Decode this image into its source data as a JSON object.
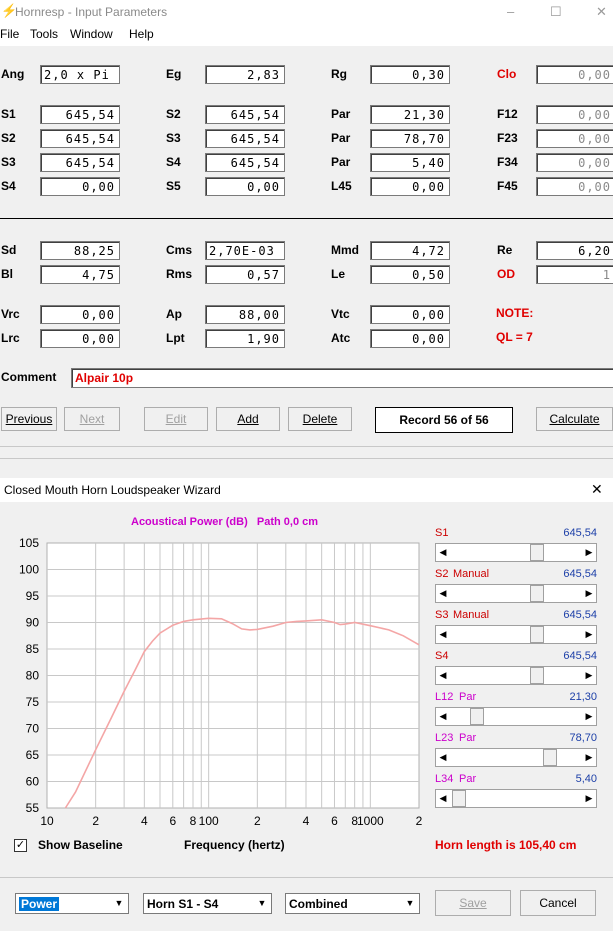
{
  "window": {
    "title": "Hornresp - Input Parameters",
    "controls": {
      "minimize": "–",
      "maximize": "☐",
      "close": "✕"
    }
  },
  "menu": [
    "File",
    "Tools",
    "Window",
    "Help"
  ],
  "params": {
    "ang": {
      "label": "Ang",
      "value": "2,0 x Pi"
    },
    "eg": {
      "label": "Eg",
      "value": "2,83"
    },
    "rg": {
      "label": "Rg",
      "value": "0,30"
    },
    "clo": {
      "label": "Clo",
      "value": "0,00"
    },
    "s1": {
      "label": "S1",
      "value": "645,54"
    },
    "s2a": {
      "label": "S2",
      "value": "645,54"
    },
    "par1": {
      "label": "Par",
      "value": "21,30"
    },
    "f12": {
      "label": "F12",
      "value": "0,00"
    },
    "s2b": {
      "label": "S2",
      "value": "645,54"
    },
    "s3a": {
      "label": "S3",
      "value": "645,54"
    },
    "par2": {
      "label": "Par",
      "value": "78,70"
    },
    "f23": {
      "label": "F23",
      "value": "0,00"
    },
    "s3b": {
      "label": "S3",
      "value": "645,54"
    },
    "s4a": {
      "label": "S4",
      "value": "645,54"
    },
    "par3": {
      "label": "Par",
      "value": "5,40"
    },
    "f34": {
      "label": "F34",
      "value": "0,00"
    },
    "s4b": {
      "label": "S4",
      "value": "0,00"
    },
    "s5": {
      "label": "S5",
      "value": "0,00"
    },
    "l45": {
      "label": "L45",
      "value": "0,00"
    },
    "f45": {
      "label": "F45",
      "value": "0,00"
    },
    "sd": {
      "label": "Sd",
      "value": "88,25"
    },
    "cms": {
      "label": "Cms",
      "value": "2,70E-03"
    },
    "mmd": {
      "label": "Mmd",
      "value": "4,72"
    },
    "re": {
      "label": "Re",
      "value": "6,20"
    },
    "bl": {
      "label": "Bl",
      "value": "4,75"
    },
    "rms": {
      "label": "Rms",
      "value": "0,57"
    },
    "le": {
      "label": "Le",
      "value": "0,50"
    },
    "od": {
      "label": "OD",
      "value": "1"
    },
    "vrc": {
      "label": "Vrc",
      "value": "0,00"
    },
    "ap": {
      "label": "Ap",
      "value": "88,00"
    },
    "vtc": {
      "label": "Vtc",
      "value": "0,00"
    },
    "lrc": {
      "label": "Lrc",
      "value": "0,00"
    },
    "lpt": {
      "label": "Lpt",
      "value": "1,90"
    },
    "atc": {
      "label": "Atc",
      "value": "0,00"
    }
  },
  "note": {
    "label": "NOTE:",
    "ql": "QL = 7"
  },
  "comment": {
    "label": "Comment",
    "value": "Alpair 10p"
  },
  "buttons": {
    "previous": "Previous",
    "next": "Next",
    "edit": "Edit",
    "add": "Add",
    "delete": "Delete",
    "record": "Record 56 of 56",
    "calculate": "Calculate"
  },
  "wizard": {
    "title": "Closed Mouth Horn Loudspeaker Wizard",
    "close": "✕",
    "chart_title": "Acoustical Power (dB)   Path 0,0 cm",
    "show_baseline": "Show Baseline",
    "xaxis_label": "Frequency (hertz)",
    "horn_length": "Horn length is 105,40 cm",
    "sliders": [
      {
        "label": "S1",
        "mode": "",
        "value": "645,54",
        "level": 0.68
      },
      {
        "label": "S2",
        "mode": "Manual",
        "value": "645,54",
        "level": 0.68
      },
      {
        "label": "S3",
        "mode": "Manual",
        "value": "645,54",
        "level": 0.68
      },
      {
        "label": "S4",
        "mode": "",
        "value": "645,54",
        "level": 0.68
      },
      {
        "label": "L12",
        "mode": "Par",
        "value": "21,30",
        "level": 0.17
      },
      {
        "label": "L23",
        "mode": "Par",
        "value": "78,70",
        "level": 0.79
      },
      {
        "label": "L34",
        "mode": "Par",
        "value": "5,40",
        "level": 0.02
      }
    ],
    "combos": {
      "plot": "Power",
      "horn": "Horn S1 - S4",
      "mode": "Combined"
    },
    "save": "Save",
    "cancel": "Cancel"
  },
  "colors": {
    "red": "#e00000",
    "magenta": "#cc00cc",
    "curve": "#f4a6a6",
    "grid": "#c8c8c8",
    "value_blue": "#1c3fa8"
  },
  "chart_data": {
    "type": "line",
    "title": "Acoustical Power (dB)   Path 0,0 cm",
    "xlabel": "Frequency (hertz)",
    "ylabel": "",
    "xscale": "log",
    "xlim": [
      10,
      2000
    ],
    "ylim": [
      55,
      105
    ],
    "yticks": [
      55,
      60,
      65,
      70,
      75,
      80,
      85,
      90,
      95,
      100,
      105
    ],
    "xtick_labels": [
      "10",
      "2",
      "4",
      "6",
      "8",
      "100",
      "2",
      "4",
      "6",
      "8",
      "1000",
      "2"
    ],
    "xtick_values": [
      10,
      20,
      40,
      60,
      80,
      100,
      200,
      400,
      600,
      800,
      1000,
      2000
    ],
    "grid": true,
    "series": [
      {
        "x": [
          13,
          15,
          20,
          25,
          30,
          35,
          40,
          45,
          50,
          60,
          70,
          80,
          100,
          120,
          140,
          160,
          180,
          200,
          250,
          300,
          350,
          400,
          500,
          600,
          650,
          700,
          800,
          1000,
          1300,
          1600,
          2000
        ],
        "y": [
          55,
          58,
          66,
          72,
          77,
          81,
          84.5,
          86.5,
          88,
          89.5,
          90.2,
          90.5,
          90.8,
          90.7,
          89.8,
          88.8,
          88.6,
          88.7,
          89.3,
          90,
          90.2,
          90.3,
          90.5,
          90,
          89.6,
          89.7,
          90,
          89.4,
          88.6,
          87.5,
          85.8
        ]
      }
    ]
  }
}
